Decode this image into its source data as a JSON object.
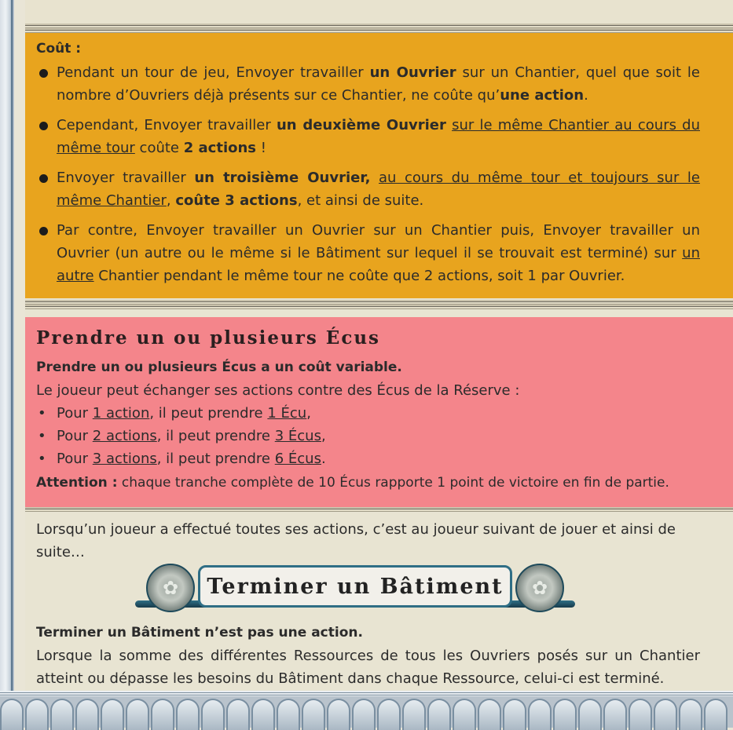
{
  "cost": {
    "title": "Coût :",
    "items": [
      [
        {
          "t": "Pendant un tour de jeu, Envoyer travailler "
        },
        {
          "t": "un Ouvrier",
          "b": true
        },
        {
          "t": " sur un Chantier, quel que soit le nombre d’Ouvriers déjà présents sur ce Chantier, ne coûte qu’"
        },
        {
          "t": "une action",
          "b": true
        },
        {
          "t": "."
        }
      ],
      [
        {
          "t": "Cependant, Envoyer travailler "
        },
        {
          "t": "un deuxième Ouvrier",
          "b": true
        },
        {
          "t": " "
        },
        {
          "t": "sur le même Chantier au cours du même tour",
          "u": true
        },
        {
          "t": " coûte "
        },
        {
          "t": "2 actions",
          "b": true
        },
        {
          "t": " !"
        }
      ],
      [
        {
          "t": "Envoyer travailler "
        },
        {
          "t": "un troisième Ouvrier,",
          "b": true
        },
        {
          "t": " "
        },
        {
          "t": "au cours du même tour et toujours sur le même Chantier",
          "u": true
        },
        {
          "t": ", "
        },
        {
          "t": "coûte 3 actions",
          "b": true
        },
        {
          "t": ", et ainsi de suite."
        }
      ],
      [
        {
          "t": "Par contre, Envoyer travailler un Ouvrier sur un Chantier puis, Envoyer travailler un Ouvrier (un autre ou le même si le Bâtiment sur lequel il se trouvait est terminé) sur "
        },
        {
          "t": "un autre",
          "u": true
        },
        {
          "t": " Chantier pendant le même tour ne coûte que 2 actions, soit 1 par Ouvrier."
        }
      ]
    ]
  },
  "take_coins": {
    "title": "Prendre un ou plusieurs Écus",
    "subtitle": "Prendre un ou plusieurs Écus a un coût variable.",
    "intro": "Le joueur peut échanger ses actions contre des Écus de la Réserve :",
    "items": [
      [
        {
          "t": "Pour "
        },
        {
          "t": "1 action",
          "u": true
        },
        {
          "t": ", il peut prendre "
        },
        {
          "t": "1 Écu",
          "u": true
        },
        {
          "t": ","
        }
      ],
      [
        {
          "t": "Pour "
        },
        {
          "t": "2 actions",
          "u": true
        },
        {
          "t": ", il peut prendre "
        },
        {
          "t": "3 Écus",
          "u": true
        },
        {
          "t": ","
        }
      ],
      [
        {
          "t": "Pour "
        },
        {
          "t": "3 actions",
          "u": true
        },
        {
          "t": ", il peut prendre "
        },
        {
          "t": "6 Écus",
          "u": true
        },
        {
          "t": "."
        }
      ]
    ],
    "attention_label": "Attention :",
    "attention_text": " chaque tranche complète de 10 Écus rapporte 1 point de victoire en fin de partie."
  },
  "after_actions": "Lorsqu’un joueur a effectué toutes ses actions, c’est au joueur suivant de jouer et ainsi de suite…",
  "banner": {
    "title": "Terminer un Bâtiment",
    "medal_icon": "rosette"
  },
  "finish": {
    "subtitle": "Terminer un Bâtiment n’est pas une action.",
    "text": "Lorsque la somme des différentes Ressources de tous les Ouvriers posés sur un Chantier atteint ou dépasse les besoins du Bâtiment dans chaque Ressource, celui-ci est terminé."
  },
  "colors": {
    "cost_bg": "#e8a41e",
    "pink_bg": "#f4858b",
    "banner_teal": "#2f6e85"
  }
}
